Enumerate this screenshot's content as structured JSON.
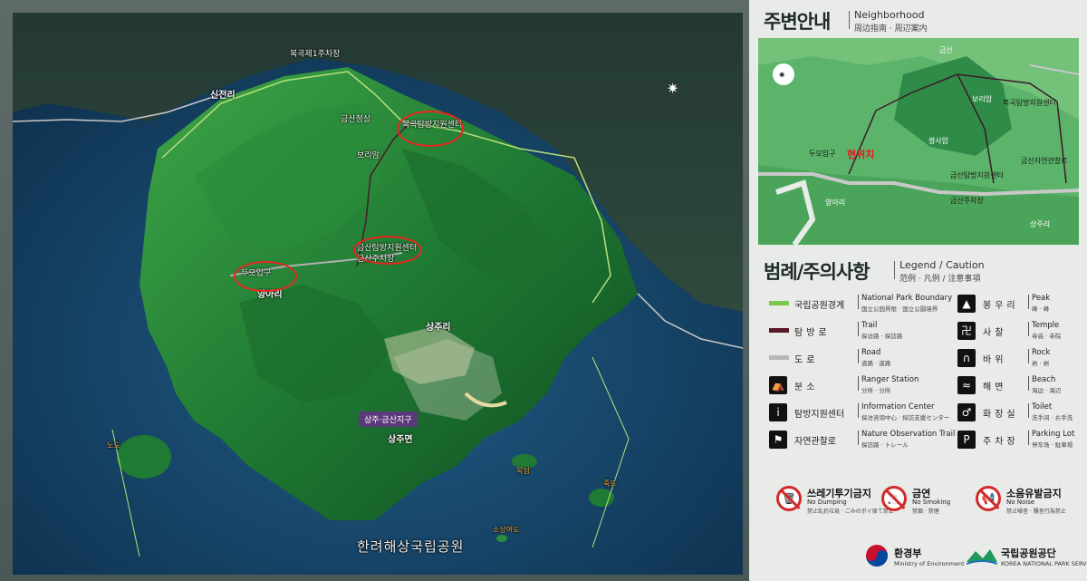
{
  "main_map": {
    "labels": {
      "sinjeon_ri": "신전리",
      "sangju_ri": "상주리",
      "yanga_ri": "양아리",
      "sangju_myeon": "상주면",
      "doyo_entrance": "두모입구",
      "geumsan_ranger": "금산탐방지원센터",
      "geumsan_parking": "금산주차장",
      "bokgok_parking": "복곡제1주차장",
      "bokgok_center": "복곡탐방지원센터",
      "geumsan_peak": "금산정상",
      "boriam": "보리암",
      "sangju_geumsan_district": "상주·금산지구",
      "sea_park": "한려해상국립공원",
      "nohwa_island": "노도",
      "moksom": "목섬",
      "sohong": "소상여도",
      "jeol_island": "죽도"
    }
  },
  "neighborhood": {
    "title_ko": "주변안내",
    "title_en": "Neighborhood",
    "title_zh": "周边指南 · 周辺案内",
    "labels": {
      "current_location": "현위치",
      "doyo_entrance": "두모입구",
      "yanga_ri": "양아리",
      "geumsan": "금산",
      "boriam": "보리암",
      "sangsaram": "쌍사암",
      "geumsan_ranger": "금산탐방지원센터",
      "geumsan_parking": "금산주차장",
      "bokgok_center": "복곡탐방지원센터",
      "nature_obs": "금산자연관찰로",
      "sangju_ri": "상주리"
    }
  },
  "legend": {
    "title_ko": "범례/주의사항",
    "title_en": "Legend / Caution",
    "title_zh": "范例 · 凡例 / 注意事項",
    "left": [
      {
        "ko": "국립공원경계",
        "en": "National Park Boundary",
        "sub": "国立公园界限 · 国立公園境界",
        "color": "#7ac94a",
        "kind": "line"
      },
      {
        "ko": "탐방로",
        "en": "Trail",
        "sub": "探访路 · 探訪路",
        "color": "#5a1a2a",
        "kind": "line"
      },
      {
        "ko": "도로",
        "en": "Road",
        "sub": "道路 · 道路",
        "color": "#b8b8b8",
        "kind": "line"
      },
      {
        "ko": "분소",
        "en": "Ranger Station",
        "sub": "分所 · 分所",
        "icon": "⛺",
        "kind": "icon"
      },
      {
        "ko": "탐방지원센터",
        "en": "Information Center",
        "sub": "探访咨询中心 · 探訪支援センター",
        "icon": "i",
        "kind": "icon"
      },
      {
        "ko": "자연관찰로",
        "en": "Nature Observation Trail",
        "sub": "探訪路 · トレール",
        "icon": "⚑",
        "kind": "icon"
      }
    ],
    "right": [
      {
        "ko": "봉우리",
        "en": "Peak",
        "sub": "峰 · 峰",
        "icon": "▲"
      },
      {
        "ko": "사찰",
        "en": "Temple",
        "sub": "寺庙 · 寺院",
        "icon": "卍"
      },
      {
        "ko": "바위",
        "en": "Rock",
        "sub": "岩 · 岩",
        "icon": "∩"
      },
      {
        "ko": "해변",
        "en": "Beach",
        "sub": "海边 · 海辺",
        "icon": "≈"
      },
      {
        "ko": "화장실",
        "en": "Toilet",
        "sub": "洗手间 · お手洗",
        "icon": "♂"
      },
      {
        "ko": "주차장",
        "en": "Parking Lot",
        "sub": "停车场 · 駐車場",
        "icon": "P"
      }
    ],
    "cautions": [
      {
        "ko": "쓰레기투기금지",
        "en": "No Dumping",
        "sub": "禁止乱扔垃圾 · ごみのポイ捨て禁止",
        "icon": "🗑"
      },
      {
        "ko": "금연",
        "en": "No Smoking",
        "sub": "禁烟 · 禁煙",
        "icon": "🚬"
      },
      {
        "ko": "소음유발금지",
        "en": "No Noise",
        "sub": "禁止噪音 · 騒音行為禁止",
        "icon": "📢"
      }
    ]
  },
  "logos": {
    "moe_ko": "환경부",
    "moe_en": "Ministry of Environment",
    "knps_ko": "국립공원공단",
    "knps_en": "KOREA NATIONAL PARK SERVICE"
  }
}
